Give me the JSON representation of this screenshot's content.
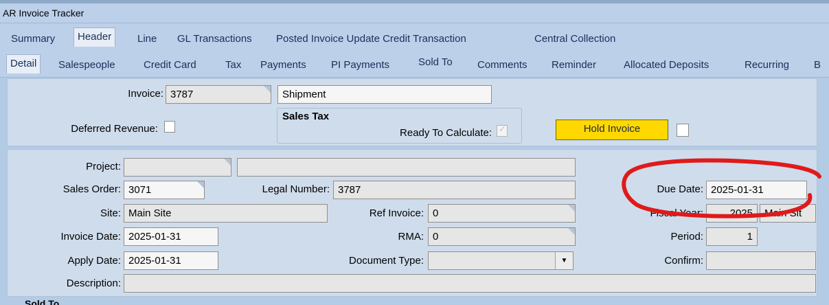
{
  "window": {
    "title": "AR Invoice Tracker"
  },
  "tabs_top": [
    "Summary",
    "Header",
    "Line",
    "GL Transactions",
    "Posted Invoice Update Credit Transaction",
    "Central Collection"
  ],
  "tabs_sub": [
    "Detail",
    "Salespeople",
    "Credit Card",
    "Tax",
    "Payments",
    "PI Payments",
    "Sold To",
    "Comments",
    "Reminder",
    "Allocated Deposits",
    "Recurring",
    "B"
  ],
  "header": {
    "invoice_label": "Invoice:",
    "invoice_value": "3787",
    "shipment_value": "Shipment",
    "deferred_revenue_label": "Deferred Revenue:",
    "sales_tax_title": "Sales Tax",
    "ready_to_calculate_label": "Ready To Calculate:",
    "hold_invoice_button": "Hold Invoice"
  },
  "details": {
    "project_label": "Project:",
    "project_value": "",
    "project_desc": "",
    "sales_order_label": "Sales Order:",
    "sales_order_value": "3071",
    "legal_number_label": "Legal Number:",
    "legal_number_value": "3787",
    "site_label": "Site:",
    "site_value": "Main Site",
    "ref_invoice_label": "Ref Invoice:",
    "ref_invoice_value": "0",
    "invoice_date_label": "Invoice Date:",
    "invoice_date_value": "2025-01-31",
    "rma_label": "RMA:",
    "rma_value": "0",
    "apply_date_label": "Apply Date:",
    "apply_date_value": "2025-01-31",
    "document_type_label": "Document Type:",
    "document_type_value": "",
    "description_label": "Description:",
    "description_value": "",
    "due_date_label": "Due Date:",
    "due_date_value": "2025-01-31",
    "fiscal_year_label": "Fiscal Year:",
    "fiscal_year_value": "2025",
    "fiscal_calendar_value": "Main Sit",
    "period_label": "Period:",
    "period_value": "1",
    "confirm_label": "Confirm:",
    "confirm_value": ""
  },
  "sold_to_heading": "Sold To",
  "colors": {
    "annotation": "#e01a1a",
    "hold_button": "#ffd800",
    "background": "#b4cbe6"
  }
}
